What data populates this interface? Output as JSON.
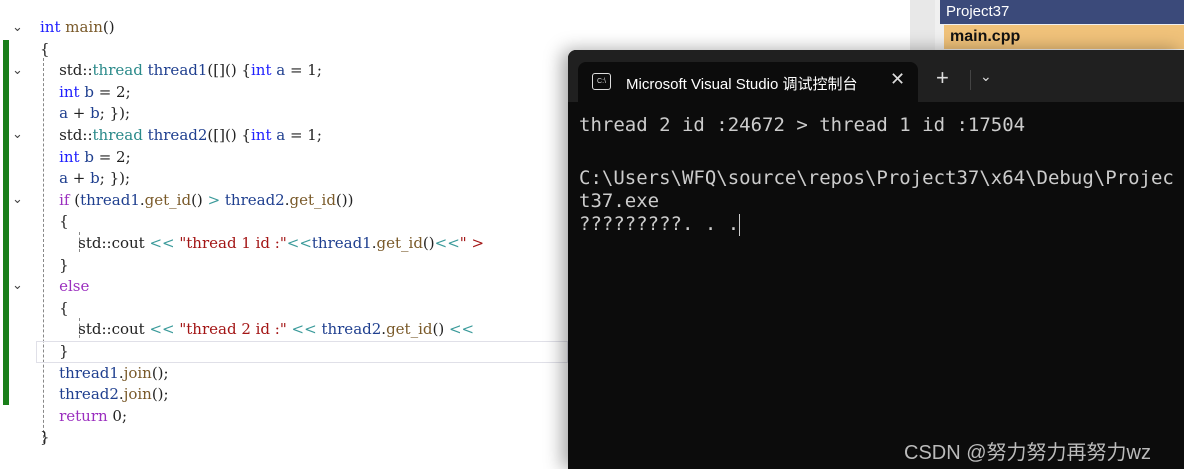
{
  "editor": {
    "lines": [
      [
        [
          "int ",
          "kw"
        ],
        [
          "main",
          "fn"
        ],
        [
          "()",
          "ns"
        ]
      ],
      [
        [
          "{",
          "ns"
        ]
      ],
      [
        [
          "    std::",
          "ns"
        ],
        [
          "thread ",
          "ty"
        ],
        [
          "thread1",
          "var"
        ],
        [
          "([]() {",
          "ns"
        ],
        [
          "int ",
          "kw"
        ],
        [
          "a",
          "var"
        ],
        [
          " = 1;",
          "ns"
        ]
      ],
      [
        [
          "    ",
          "ns"
        ],
        [
          "int ",
          "kw"
        ],
        [
          "b",
          "var"
        ],
        [
          " = 2;",
          "ns"
        ]
      ],
      [
        [
          "    ",
          "ns"
        ],
        [
          "a",
          "var"
        ],
        [
          " + ",
          "ns"
        ],
        [
          "b",
          "var"
        ],
        [
          "; });",
          "ns"
        ]
      ],
      [
        [
          "    std::",
          "ns"
        ],
        [
          "thread ",
          "ty"
        ],
        [
          "thread2",
          "var"
        ],
        [
          "([]() {",
          "ns"
        ],
        [
          "int ",
          "kw"
        ],
        [
          "a",
          "var"
        ],
        [
          " = 1;",
          "ns"
        ]
      ],
      [
        [
          "    ",
          "ns"
        ],
        [
          "int ",
          "kw"
        ],
        [
          "b",
          "var"
        ],
        [
          " = 2;",
          "ns"
        ]
      ],
      [
        [
          "    ",
          "ns"
        ],
        [
          "a",
          "var"
        ],
        [
          " + ",
          "ns"
        ],
        [
          "b",
          "var"
        ],
        [
          "; });",
          "ns"
        ]
      ],
      [
        [
          "    ",
          "ns"
        ],
        [
          "if ",
          "ctl"
        ],
        [
          "(",
          "ns"
        ],
        [
          "thread1",
          "var"
        ],
        [
          ".",
          "ns"
        ],
        [
          "get_id",
          "fn"
        ],
        [
          "() ",
          "ns"
        ],
        [
          "> ",
          "op"
        ],
        [
          "thread2",
          "var"
        ],
        [
          ".",
          "ns"
        ],
        [
          "get_id",
          "fn"
        ],
        [
          "())",
          "ns"
        ]
      ],
      [
        [
          "    {",
          "ns"
        ]
      ],
      [
        [
          "        std::cout ",
          "ns"
        ],
        [
          "<< ",
          "op"
        ],
        [
          "\"thread 1 id :\"",
          "str"
        ],
        [
          "<<",
          "op"
        ],
        [
          "thread1",
          "var"
        ],
        [
          ".",
          "ns"
        ],
        [
          "get_id",
          "fn"
        ],
        [
          "()",
          "ns"
        ],
        [
          "<<",
          "op"
        ],
        [
          "\" > ",
          "str"
        ]
      ],
      [
        [
          "    }",
          "ns"
        ]
      ],
      [
        [
          "    ",
          "ns"
        ],
        [
          "else",
          "ctl"
        ]
      ],
      [
        [
          "    {",
          "ns"
        ]
      ],
      [
        [
          "        std::cout ",
          "ns"
        ],
        [
          "<< ",
          "op"
        ],
        [
          "\"thread 2 id :\"",
          "str"
        ],
        [
          " << ",
          "op"
        ],
        [
          "thread2",
          "var"
        ],
        [
          ".",
          "ns"
        ],
        [
          "get_id",
          "fn"
        ],
        [
          "() ",
          "ns"
        ],
        [
          "<< ",
          "op"
        ]
      ],
      [
        [
          "    }",
          "ns"
        ]
      ],
      [
        [
          "    ",
          "ns"
        ],
        [
          "thread1",
          "var"
        ],
        [
          ".",
          "ns"
        ],
        [
          "join",
          "fn"
        ],
        [
          "();",
          "ns"
        ]
      ],
      [
        [
          "    ",
          "ns"
        ],
        [
          "thread2",
          "var"
        ],
        [
          ".",
          "ns"
        ],
        [
          "join",
          "fn"
        ],
        [
          "();",
          "ns"
        ]
      ],
      [
        [
          "    ",
          "ns"
        ],
        [
          "return ",
          "ctl"
        ],
        [
          "0;",
          "ns"
        ]
      ],
      [
        [
          "}",
          "ns"
        ]
      ]
    ]
  },
  "solution_explorer": {
    "project": "Project37",
    "file": "main.cpp"
  },
  "terminal": {
    "tab_title": "Microsoft Visual Studio 调试控制台",
    "tab_icon": "C:\\",
    "close": "✕",
    "new_tab": "+",
    "dropdown": "⌄",
    "output": [
      "thread 2 id :24672 > thread 1 id :17504",
      "",
      "C:\\Users\\WFQ\\source\\repos\\Project37\\x64\\Debug\\Project37.exe",
      "?????????. . ."
    ]
  },
  "watermark": "CSDN @努力努力再努力wz"
}
